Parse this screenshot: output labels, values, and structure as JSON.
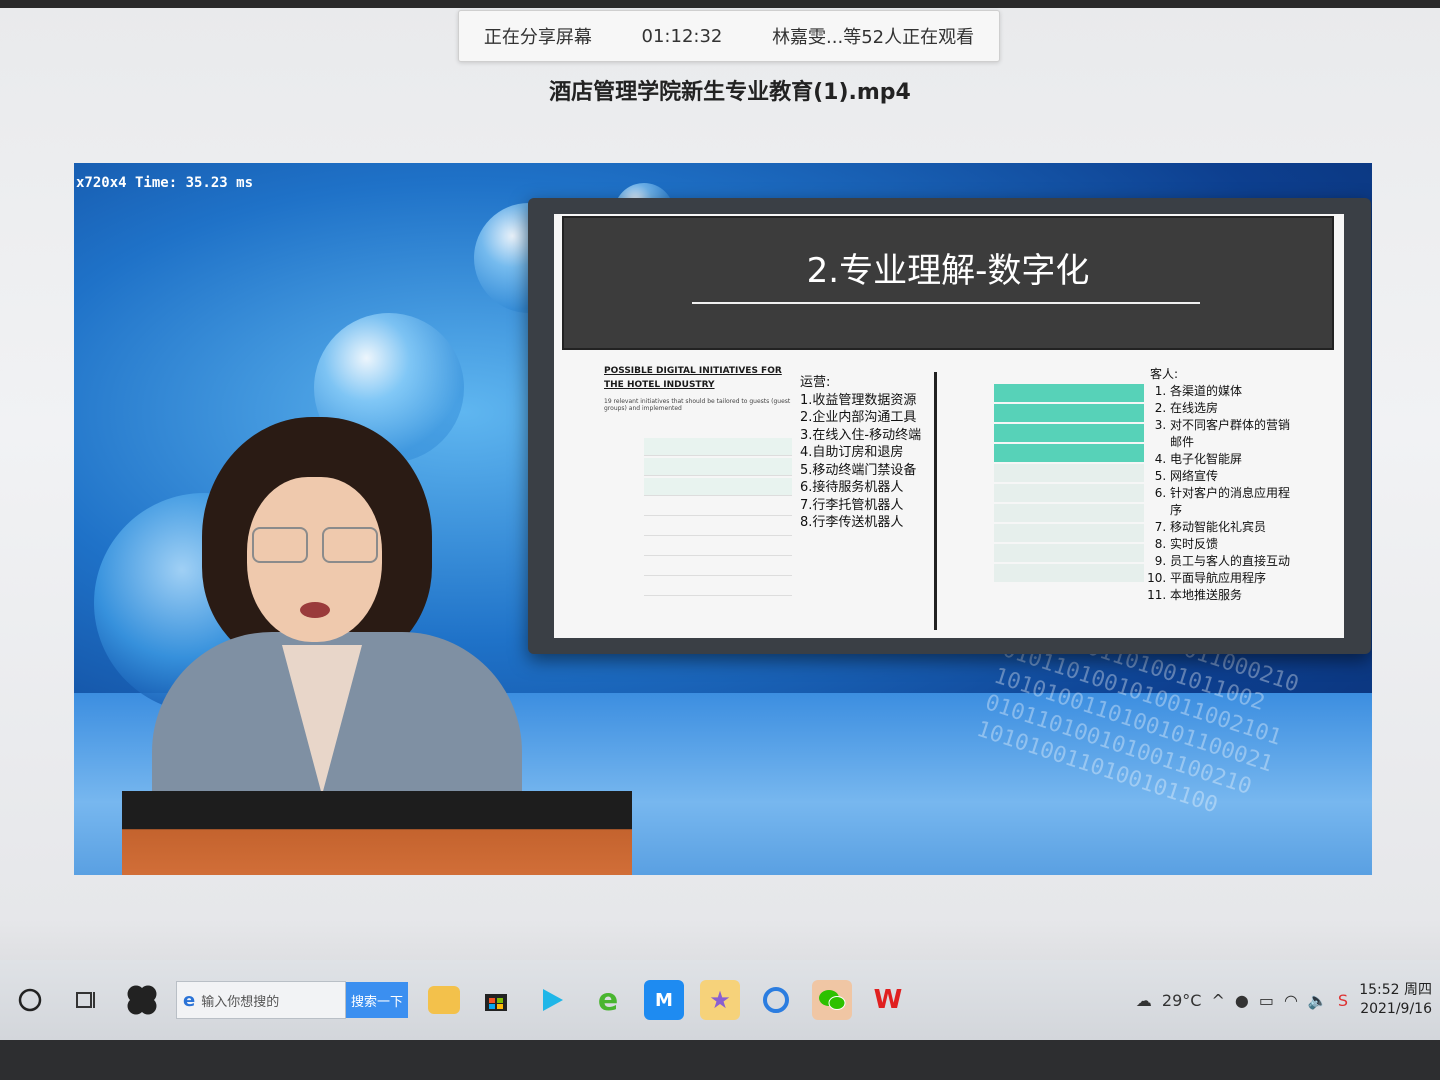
{
  "share_bar": {
    "status": "正在分享屏幕",
    "elapsed": "01:12:32",
    "viewers": "林嘉雯...等52人正在观看"
  },
  "video_title": "酒店管理学院新生专业教育(1).mp4",
  "player": {
    "overlay_stat": "x720x4 Time: 35.23 ms"
  },
  "slide": {
    "title": "2.专业理解-数字化",
    "left_heading": "POSSIBLE DIGITAL INITIATIVES FOR THE HOTEL INDUSTRY",
    "left_sub": "19 relevant initiatives that should be tailored to guests (guest groups) and implemented",
    "ops_label": "运营:",
    "ops_items": [
      "1.收益管理数据资源",
      "2.企业内部沟通工具",
      "3.在线入住-移动终端",
      "4.自助订房和退房",
      "5.移动终端门禁设备",
      "6.接待服务机器人",
      "7.行李托管机器人",
      "8.行李传送机器人"
    ],
    "guest_label": "客人:",
    "guest_items": [
      "各渠道的媒体",
      "在线选房",
      "对不同客户群体的营销邮件",
      "电子化智能屏",
      "网络宣传",
      "针对客户的消息应用程序",
      "移动智能化礼宾员",
      "实时反馈",
      "员工与客人的直接互动",
      "平面导航应用程序",
      "本地推送服务"
    ]
  },
  "taskbar": {
    "search_placeholder": "输入你想搜的",
    "search_button": "搜索一下",
    "weather": "29°C",
    "time": "15:52 周四",
    "date": "2021/9/16"
  }
}
